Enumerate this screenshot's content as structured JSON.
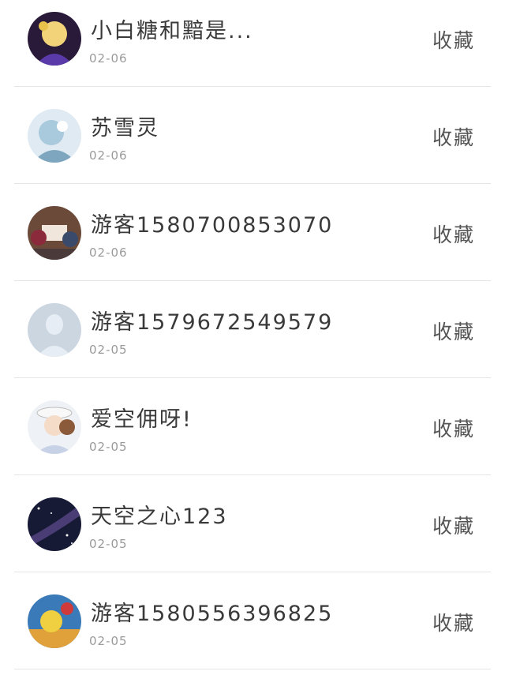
{
  "items": [
    {
      "name": "小白糖和黯是...",
      "date": "02-06",
      "action": "收藏",
      "avatar": "anime-avatar-dark"
    },
    {
      "name": "苏雪灵",
      "date": "02-06",
      "action": "收藏",
      "avatar": "anime-avatar-blue"
    },
    {
      "name": "游客1580700853070",
      "date": "02-06",
      "action": "收藏",
      "avatar": "photo-avatar-group"
    },
    {
      "name": "游客1579672549579",
      "date": "02-05",
      "action": "收藏",
      "avatar": "default-avatar"
    },
    {
      "name": "爱空佣呀!",
      "date": "02-05",
      "action": "收藏",
      "avatar": "anime-avatar-girl"
    },
    {
      "name": "天空之心123",
      "date": "02-05",
      "action": "收藏",
      "avatar": "galaxy-avatar"
    },
    {
      "name": "游客1580556396825",
      "date": "02-05",
      "action": "收藏",
      "avatar": "colorful-avatar"
    }
  ]
}
